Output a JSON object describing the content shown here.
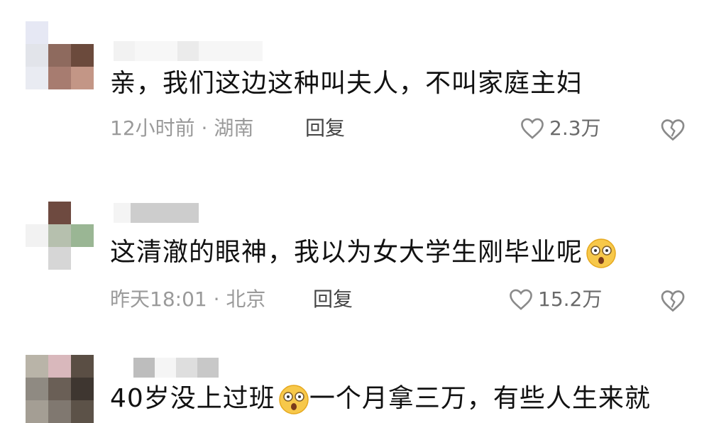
{
  "colors": {
    "text": "#111111",
    "meta": "#9a9a9a",
    "reply": "#444444",
    "likes": "#6a6a6a",
    "icon": "#8a8a8a"
  },
  "comments": [
    {
      "text": "亲，我们这边这种叫夫人，不叫家庭主妇",
      "meta": "12小时前 · 湖南",
      "reply": "回复",
      "likes": "2.3万",
      "icons": {
        "like": "heart-icon",
        "dislike": "broken-heart-icon"
      }
    },
    {
      "text": "这清澈的眼神，我以为女大学生刚毕业呢",
      "emoji": "surprised-emoji-icon",
      "meta": "昨天18:01 · 北京",
      "reply": "回复",
      "likes": "15.2万",
      "icons": {
        "like": "heart-icon",
        "dislike": "broken-heart-icon"
      }
    },
    {
      "text": "40岁没上过班",
      "emoji": "surprised-emoji-icon",
      "text_after": "一个月拿三万，有些人生来就"
    }
  ]
}
